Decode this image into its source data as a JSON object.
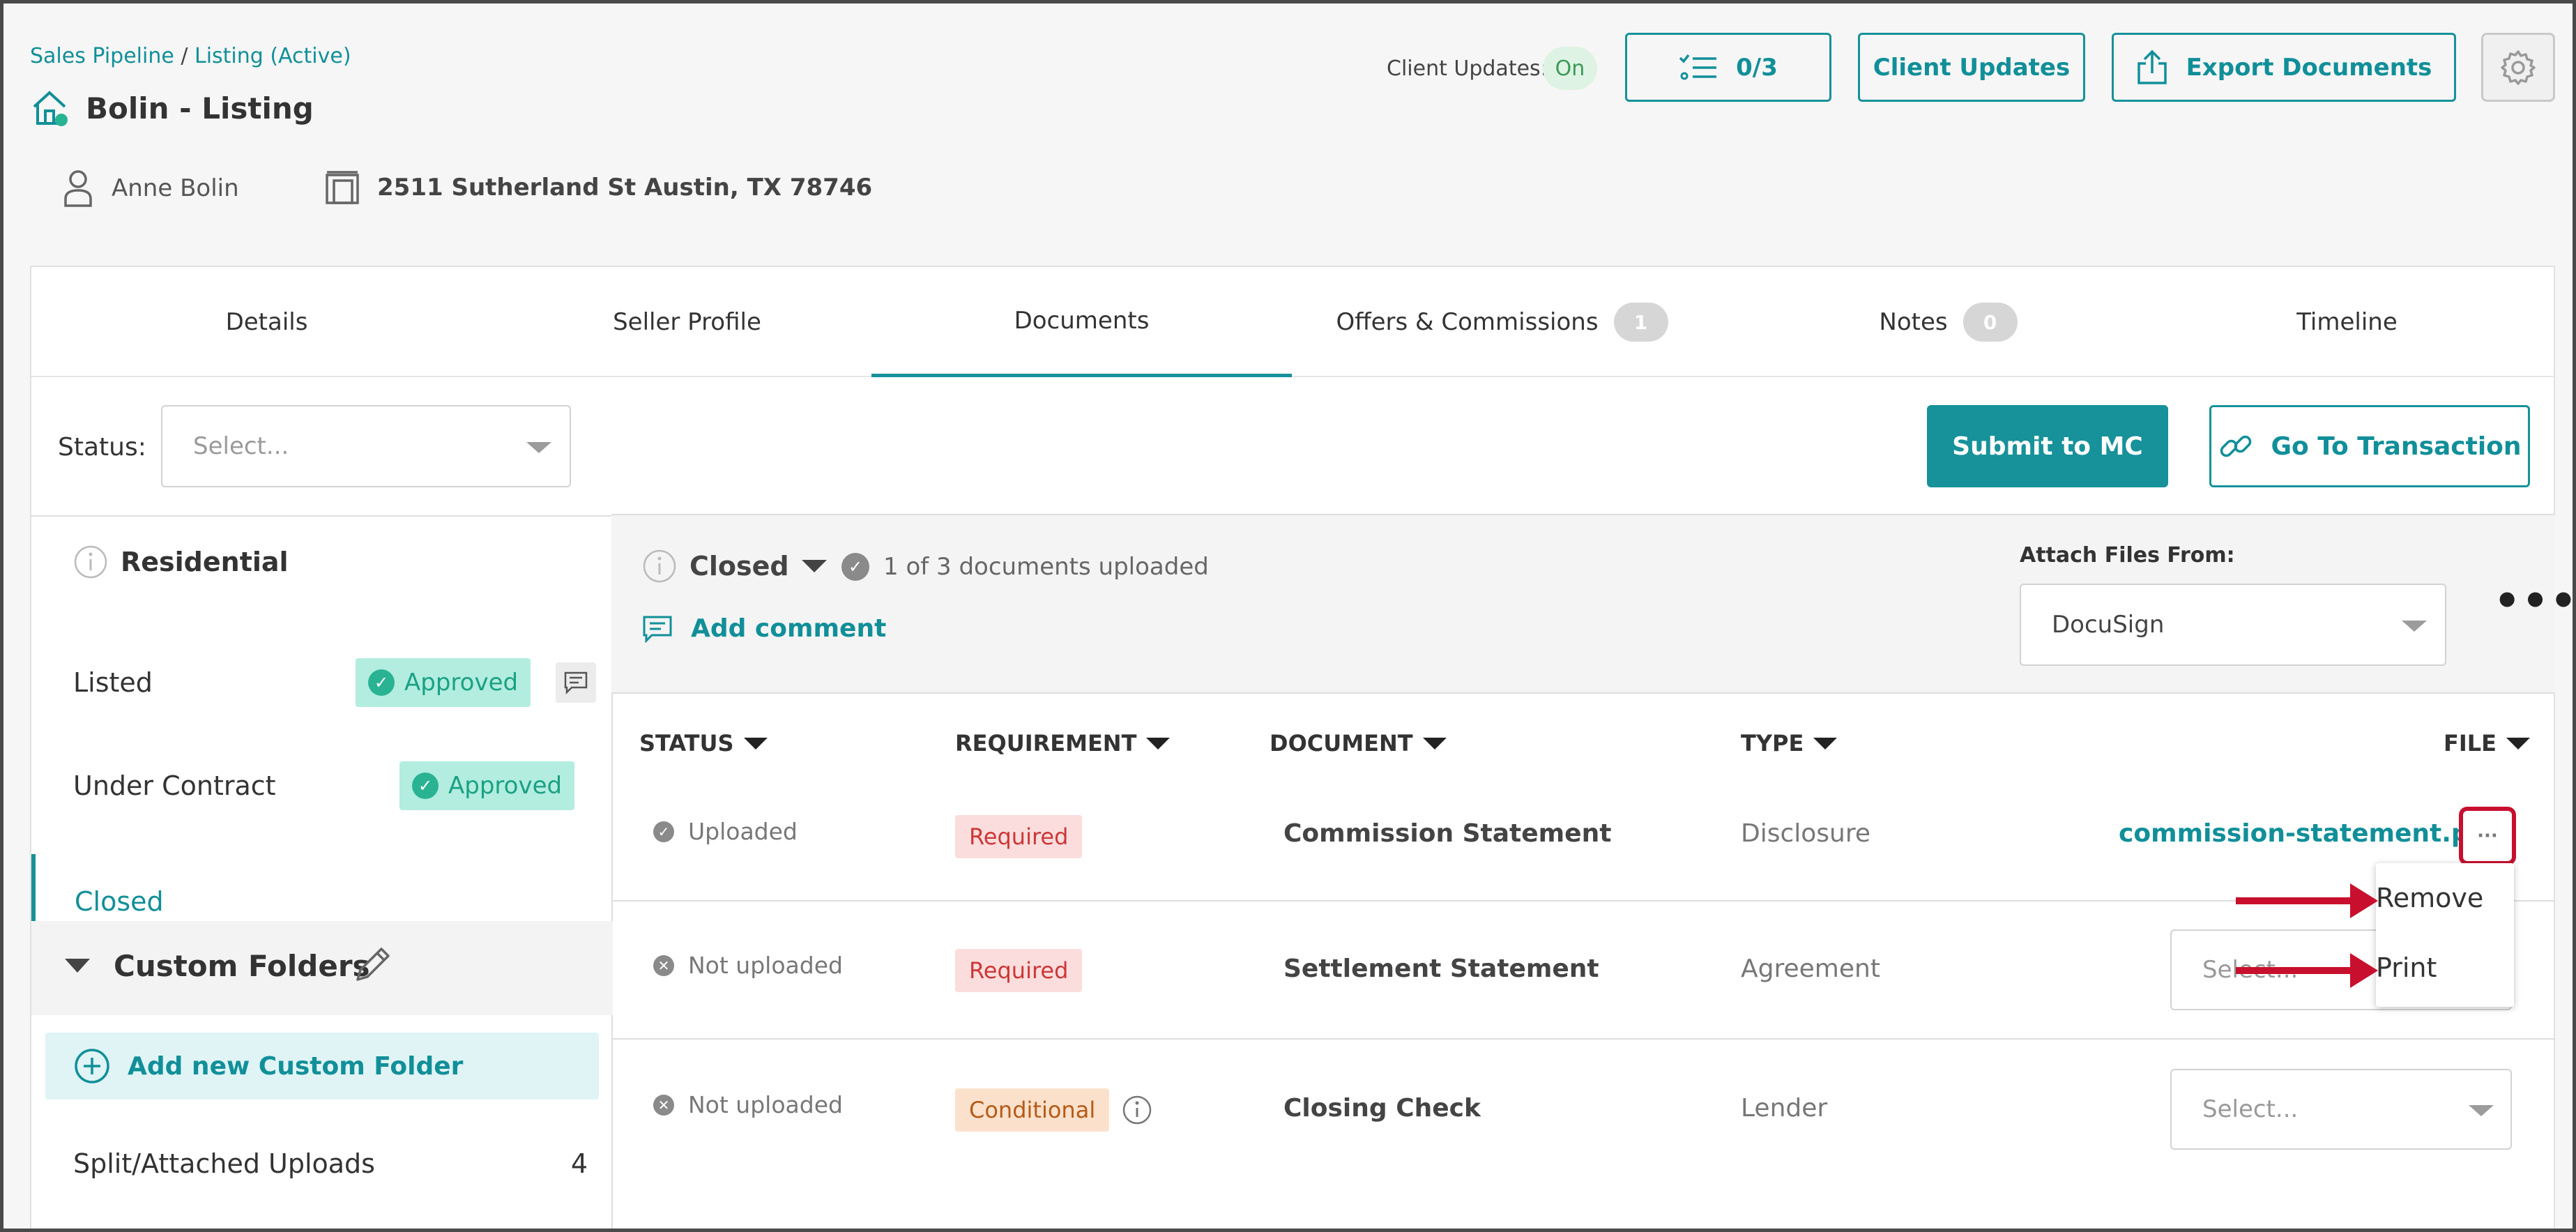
{
  "breadcrumb": {
    "part1": "Sales Pipeline",
    "sep": " / ",
    "part2": "Listing (Active)"
  },
  "page": {
    "title": "Bolin - Listing",
    "owner": "Anne Bolin",
    "address": "2511 Sutherland St Austin, TX 78746"
  },
  "header": {
    "client_updates_label": "Client Updates:",
    "client_updates_state": "On",
    "tasks_count": "0/3",
    "client_updates_button": "Client Updates",
    "export_button": "Export Documents"
  },
  "tabs": [
    {
      "label": "Details"
    },
    {
      "label": "Seller Profile"
    },
    {
      "label": "Documents"
    },
    {
      "label": "Offers & Commissions",
      "badge": "1"
    },
    {
      "label": "Notes",
      "badge": "0"
    },
    {
      "label": "Timeline"
    }
  ],
  "toolbar": {
    "status_label": "Status:",
    "status_placeholder": "Select...",
    "submit_button": "Submit to MC",
    "goto_button": "Go To Transaction"
  },
  "sidebar": {
    "residential": "Residential",
    "items": [
      {
        "label": "Listed",
        "status": "Approved"
      },
      {
        "label": "Under Contract",
        "status": "Approved"
      },
      {
        "label": "Closed"
      }
    ],
    "custom_folders": "Custom Folders",
    "add_folder": "Add new Custom Folder",
    "split_uploads": "Split/Attached Uploads",
    "split_count": "4"
  },
  "main": {
    "stage": "Closed",
    "uploaded_note": "1 of 3 documents uploaded",
    "add_comment": "Add comment",
    "attach_label": "Attach Files From:",
    "attach_value": "DocuSign",
    "more": "•••"
  },
  "table": {
    "columns": [
      "STATUS",
      "REQUIREMENT",
      "DOCUMENT",
      "TYPE",
      "FILE"
    ],
    "rows": [
      {
        "status": "Uploaded",
        "requirement": "Required",
        "document": "Commission Statement",
        "type": "Disclosure",
        "file": "commission-statement.pdf"
      },
      {
        "status": "Not uploaded",
        "requirement": "Required",
        "document": "Settlement Statement",
        "type": "Agreement",
        "file": "Select..."
      },
      {
        "status": "Not uploaded",
        "requirement": "Conditional",
        "document": "Closing Check",
        "type": "Lender",
        "file": "Select..."
      }
    ]
  },
  "file_menu": {
    "kebab": "···",
    "remove": "Remove",
    "print": "Print"
  },
  "colors": {
    "accent": "#17919a",
    "approved_bg": "#b2ede0",
    "required_bg": "#fbdddd",
    "conditional_bg": "#fbe1cc",
    "highlight": "#c8102e"
  },
  "icons": [
    "house-icon",
    "person-icon",
    "building-icon",
    "checklist-icon",
    "upload-icon",
    "gear-icon",
    "link-icon",
    "info-icon",
    "check-circle-icon",
    "comment-icon",
    "pencil-icon",
    "plus-circle-icon",
    "x-circle-icon",
    "chevron-down-icon",
    "red-arrow-icon"
  ]
}
